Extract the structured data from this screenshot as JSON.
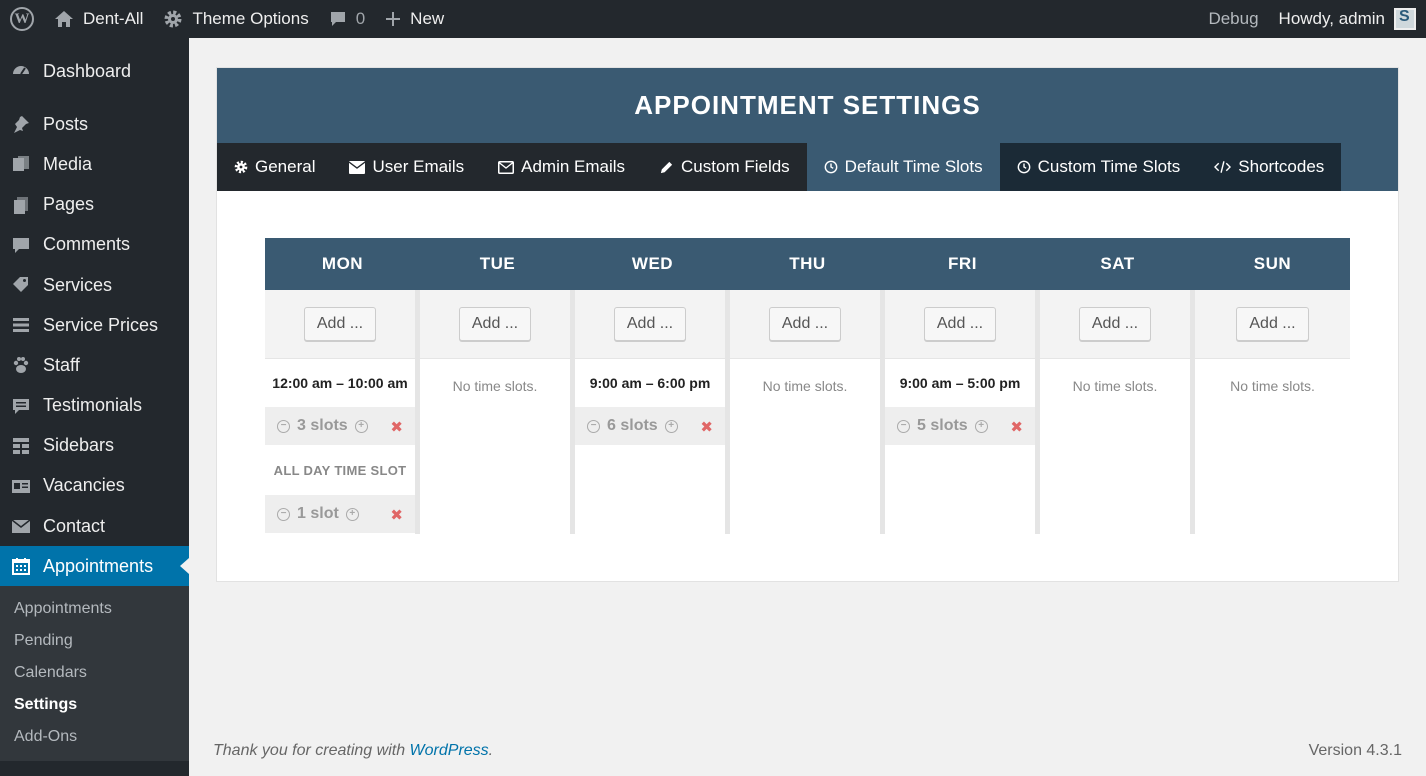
{
  "adminbar": {
    "site_name": "Dent-All",
    "theme_options": "Theme Options",
    "comments_count": "0",
    "new_label": "New",
    "debug": "Debug",
    "howdy": "Howdy, admin"
  },
  "sidebar": {
    "items": [
      {
        "label": "Dashboard",
        "icon": "dashboard-icon"
      },
      {
        "label": "Posts",
        "icon": "pin-icon"
      },
      {
        "label": "Media",
        "icon": "media-icon"
      },
      {
        "label": "Pages",
        "icon": "pages-icon"
      },
      {
        "label": "Comments",
        "icon": "comment-icon"
      },
      {
        "label": "Services",
        "icon": "tag-icon"
      },
      {
        "label": "Service Prices",
        "icon": "list-icon"
      },
      {
        "label": "Staff",
        "icon": "paw-icon"
      },
      {
        "label": "Testimonials",
        "icon": "quote-icon"
      },
      {
        "label": "Sidebars",
        "icon": "grid-icon"
      },
      {
        "label": "Vacancies",
        "icon": "id-icon"
      },
      {
        "label": "Contact",
        "icon": "mail-icon"
      },
      {
        "label": "Appointments",
        "icon": "calendar-icon"
      }
    ],
    "submenu": [
      "Appointments",
      "Pending",
      "Calendars",
      "Settings",
      "Add-Ons"
    ]
  },
  "panel": {
    "title": "APPOINTMENT SETTINGS",
    "tabs": [
      {
        "label": "General",
        "icon": "gear-icon"
      },
      {
        "label": "User Emails",
        "icon": "envelope-icon"
      },
      {
        "label": "Admin Emails",
        "icon": "envelope-outline-icon"
      },
      {
        "label": "Custom Fields",
        "icon": "pencil-icon"
      },
      {
        "label": "Default Time Slots",
        "icon": "clock-icon"
      },
      {
        "label": "Custom Time Slots",
        "icon": "clock-icon"
      },
      {
        "label": "Shortcodes",
        "icon": "code-icon"
      }
    ]
  },
  "calendar": {
    "add_label": "Add ...",
    "no_slots": "No time slots.",
    "days": [
      "MON",
      "TUE",
      "WED",
      "THU",
      "FRI",
      "SAT",
      "SUN"
    ],
    "mon": {
      "range": "12:00 am – 10:00 am",
      "slots": "3 slots",
      "allday_label": "ALL DAY TIME SLOT",
      "allday_slots": "1 slot"
    },
    "wed": {
      "range": "9:00 am – 6:00 pm",
      "slots": "6 slots"
    },
    "fri": {
      "range": "9:00 am – 5:00 pm",
      "slots": "5 slots"
    }
  },
  "footer": {
    "thanks": "Thank you for creating with ",
    "wordpress": "WordPress",
    "period": ".",
    "version": "Version 4.3.1"
  },
  "colors": {
    "admin_bar": "#23282d",
    "header_blue": "#3a5a72",
    "active_menu": "#0073aa",
    "delete_red": "#e06666"
  }
}
